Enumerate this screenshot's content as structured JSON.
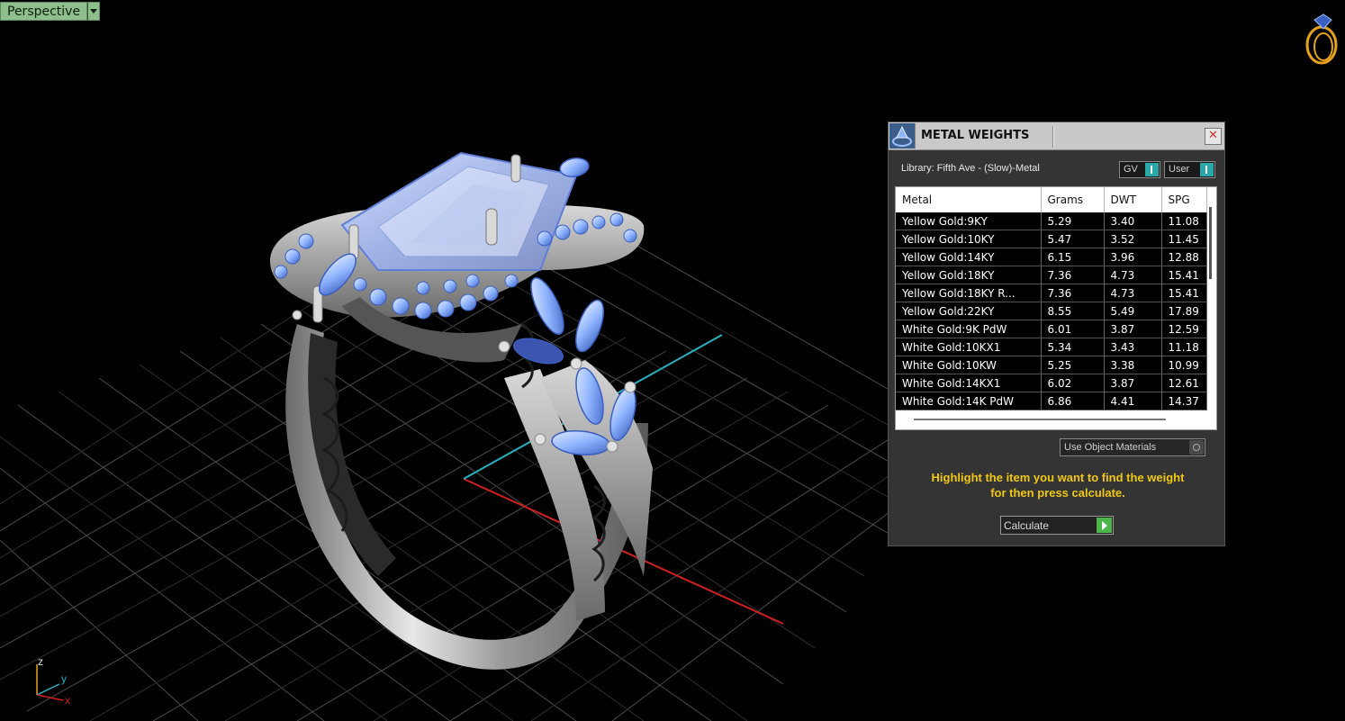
{
  "viewport": {
    "label": "Perspective",
    "axis_labels": {
      "x": "x",
      "y": "y",
      "z": "z"
    }
  },
  "panel": {
    "title": "METAL WEIGHTS",
    "library": "Library: Fifth Ave - (Slow)-Metal",
    "toggle_gv": "GV",
    "toggle_user": "User",
    "columns": [
      "Metal",
      "Grams",
      "DWT",
      "SPG"
    ],
    "rows": [
      [
        "Yellow Gold:9KY",
        "5.29",
        "3.40",
        "11.08"
      ],
      [
        "Yellow Gold:10KY",
        "5.47",
        "3.52",
        "11.45"
      ],
      [
        "Yellow Gold:14KY",
        "6.15",
        "3.96",
        "12.88"
      ],
      [
        "Yellow Gold:18KY",
        "7.36",
        "4.73",
        "15.41"
      ],
      [
        "Yellow Gold:18KY R...",
        "7.36",
        "4.73",
        "15.41"
      ],
      [
        "Yellow Gold:22KY",
        "8.55",
        "5.49",
        "17.89"
      ],
      [
        "White Gold:9K PdW",
        "6.01",
        "3.87",
        "12.59"
      ],
      [
        "White Gold:10KX1",
        "5.34",
        "3.43",
        "11.18"
      ],
      [
        "White Gold:10KW",
        "5.25",
        "3.38",
        "10.99"
      ],
      [
        "White Gold:14KX1",
        "6.02",
        "3.87",
        "12.61"
      ],
      [
        "White Gold:14K PdW",
        "6.86",
        "4.41",
        "14.37"
      ]
    ],
    "material_option": "Use Object Materials",
    "instruction_line1": "Highlight the item you want to find the weight",
    "instruction_line2": "for then press calculate.",
    "calculate_label": "Calculate"
  },
  "colors": {
    "instruction_text": "#f0c814",
    "stone_blue": "#8fb4ff",
    "metal_silver": "#c9c9c9",
    "axis_x": "#d02020",
    "axis_y": "#2ab0c0",
    "calc_button": "#4ab548"
  },
  "icons": [
    "ring-logo-icon",
    "metal-weights-logo-icon",
    "close-icon",
    "dropdown-arrow-icon",
    "play-icon"
  ]
}
